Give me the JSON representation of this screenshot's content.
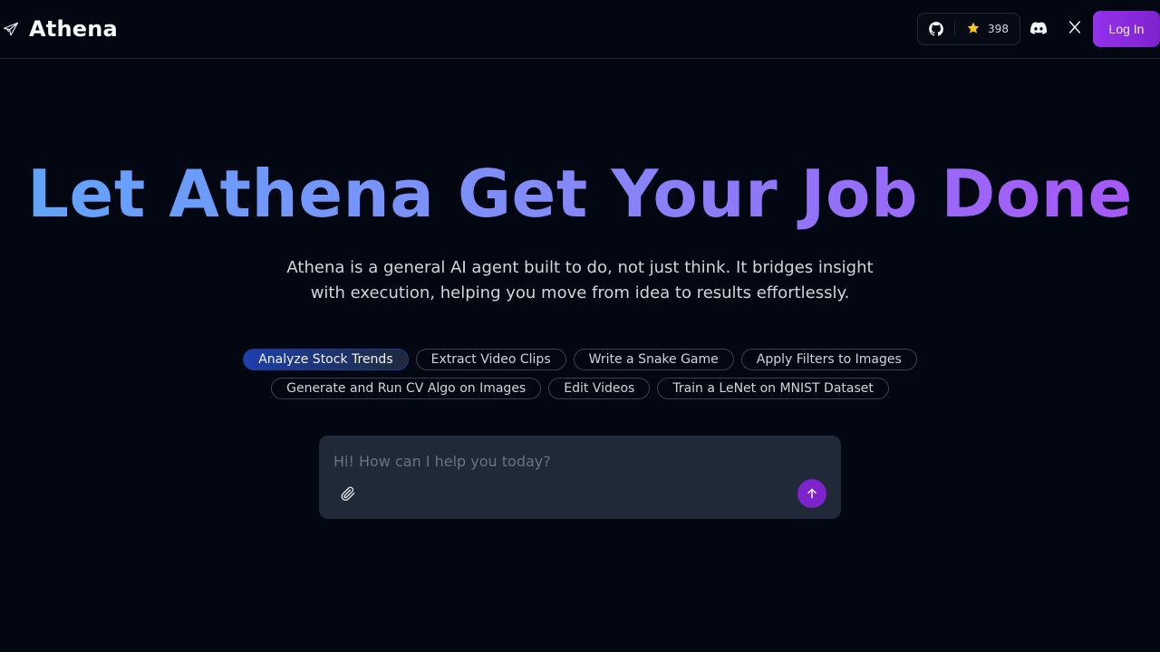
{
  "header": {
    "brand_name": "Athena",
    "logo_icon": "paper-plane-icon",
    "github_icon": "github-icon",
    "star_icon": "star-icon",
    "star_count": "398",
    "discord_icon": "discord-icon",
    "x_icon": "x-twitter-icon",
    "login_label": "Log In"
  },
  "hero": {
    "title": "Let Athena Get Your Job Done",
    "subtitle": "Athena is a general AI agent built to do, not just think. It bridges insight with execution, helping you move from idea to results effortlessly."
  },
  "suggestions": [
    {
      "label": "Analyze Stock Trends",
      "active": true
    },
    {
      "label": "Extract Video Clips",
      "active": false
    },
    {
      "label": "Write a Snake Game",
      "active": false
    },
    {
      "label": "Apply Filters to Images",
      "active": false
    },
    {
      "label": "Generate and Run CV Algo on Images",
      "active": false
    },
    {
      "label": "Edit Videos",
      "active": false
    },
    {
      "label": "Train a LeNet on MNIST Dataset",
      "active": false
    }
  ],
  "composer": {
    "placeholder": "Hi! How can I help you today?",
    "value": "",
    "attach_icon": "paperclip-icon",
    "send_icon": "arrow-up-icon"
  },
  "colors": {
    "background": "#030712",
    "accent": "#7e22ce",
    "star": "#facc15",
    "chip_active": "#1e40af"
  }
}
